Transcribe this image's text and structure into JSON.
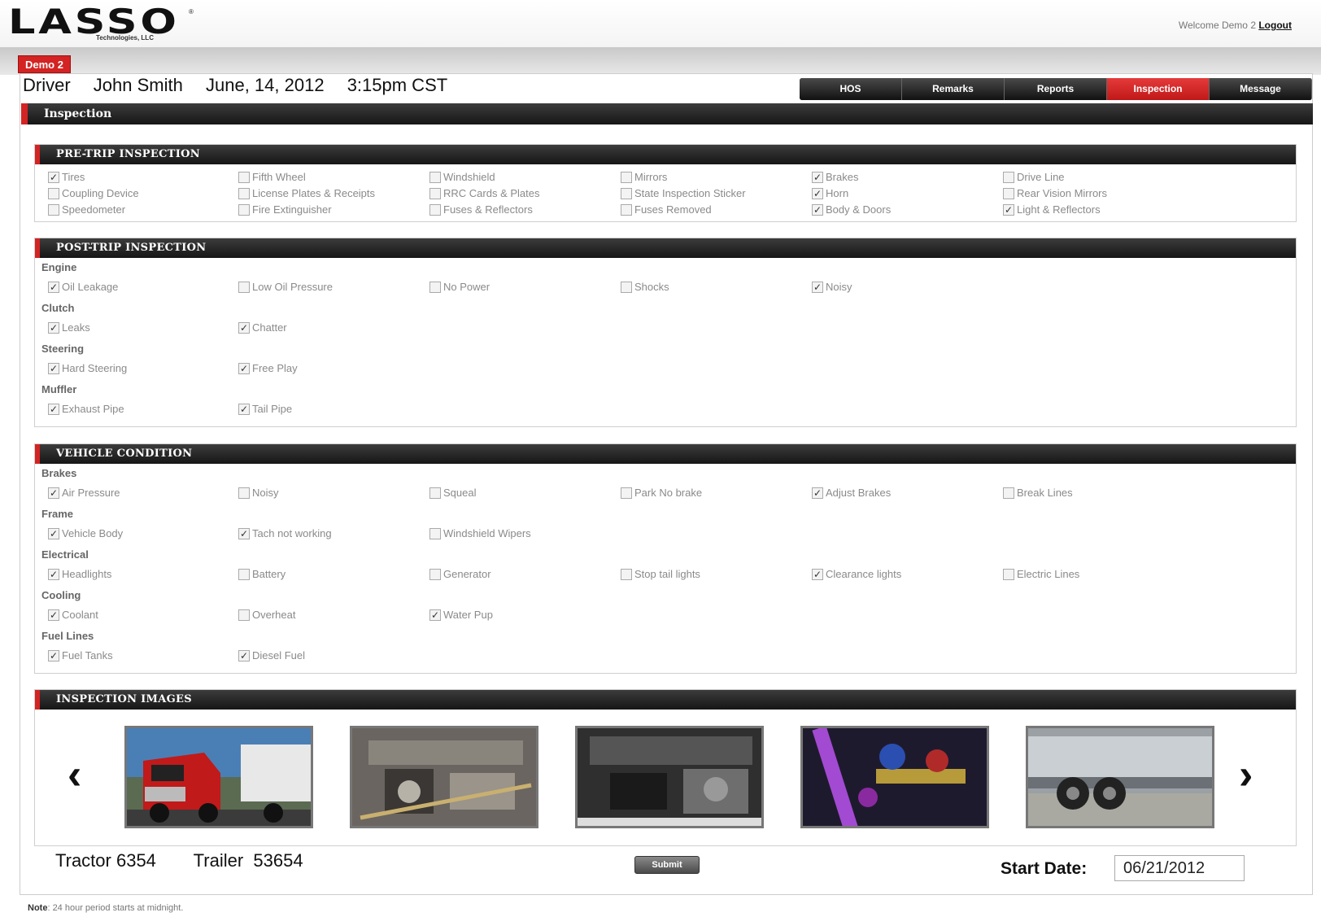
{
  "header": {
    "logo_mark": "LASSO",
    "logo_tm": "®",
    "logo_sub": "Technologies, LLC",
    "welcome": "Welcome Demo 2",
    "logout": "Logout",
    "account_tab": "Demo 2"
  },
  "driver": {
    "label": "Driver",
    "name": "John Smith",
    "date": "June, 14, 2012",
    "time": "3:15pm CST"
  },
  "nav": [
    {
      "label": "HOS",
      "active": false
    },
    {
      "label": "Remarks",
      "active": false
    },
    {
      "label": "Reports",
      "active": false
    },
    {
      "label": "Inspection",
      "active": true
    },
    {
      "label": "Message",
      "active": false
    }
  ],
  "page_title": "Inspection",
  "pretrip": {
    "title": "PRE-TRIP INSPECTION",
    "rows": [
      [
        {
          "l": "Tires",
          "c": true
        },
        {
          "l": "Fifth Wheel",
          "c": false
        },
        {
          "l": "Windshield",
          "c": false
        },
        {
          "l": "Mirrors",
          "c": false
        },
        {
          "l": "Brakes",
          "c": true
        },
        {
          "l": "Drive Line",
          "c": false
        }
      ],
      [
        {
          "l": "Coupling Device",
          "c": false
        },
        {
          "l": "License Plates & Receipts",
          "c": false
        },
        {
          "l": "RRC Cards & Plates",
          "c": false
        },
        {
          "l": "State Inspection Sticker",
          "c": false
        },
        {
          "l": "Horn",
          "c": true
        },
        {
          "l": "Rear Vision Mirrors",
          "c": false
        }
      ],
      [
        {
          "l": "Speedometer",
          "c": false
        },
        {
          "l": "Fire Extinguisher",
          "c": false
        },
        {
          "l": "Fuses & Reflectors",
          "c": false
        },
        {
          "l": "Fuses Removed",
          "c": false
        },
        {
          "l": "Body & Doors",
          "c": true
        },
        {
          "l": "Light & Reflectors",
          "c": true
        }
      ]
    ]
  },
  "posttrip": {
    "title": "POST-TRIP INSPECTION",
    "groups": [
      {
        "name": "Engine",
        "items": [
          {
            "l": "Oil Leakage",
            "c": true
          },
          {
            "l": "Low Oil Pressure",
            "c": false
          },
          {
            "l": "No Power",
            "c": false
          },
          {
            "l": "Shocks",
            "c": false
          },
          {
            "l": "Noisy",
            "c": true
          }
        ]
      },
      {
        "name": "Clutch",
        "items": [
          {
            "l": "Leaks",
            "c": true
          },
          {
            "l": "Chatter",
            "c": true
          }
        ]
      },
      {
        "name": "Steering",
        "items": [
          {
            "l": "Hard Steering",
            "c": true
          },
          {
            "l": "Free Play",
            "c": true
          }
        ]
      },
      {
        "name": "Muffler",
        "items": [
          {
            "l": "Exhaust Pipe",
            "c": true
          },
          {
            "l": "Tail Pipe",
            "c": true
          }
        ]
      }
    ]
  },
  "vehicle": {
    "title": "VEHICLE CONDITION",
    "groups": [
      {
        "name": "Brakes",
        "items": [
          {
            "l": "Air Pressure",
            "c": true
          },
          {
            "l": "Noisy",
            "c": false
          },
          {
            "l": "Squeal",
            "c": false
          },
          {
            "l": "Park No brake",
            "c": false
          },
          {
            "l": "Adjust Brakes",
            "c": true
          },
          {
            "l": "Break Lines",
            "c": false
          }
        ]
      },
      {
        "name": "Frame",
        "items": [
          {
            "l": "Vehicle Body",
            "c": true
          },
          {
            "l": "Tach not working",
            "c": true
          },
          {
            "l": "Windshield Wipers",
            "c": false
          }
        ]
      },
      {
        "name": "Electrical",
        "items": [
          {
            "l": "Headlights",
            "c": true
          },
          {
            "l": "Battery",
            "c": false
          },
          {
            "l": "Generator",
            "c": false
          },
          {
            "l": "Stop tail lights",
            "c": false
          },
          {
            "l": "Clearance lights",
            "c": true
          },
          {
            "l": "Electric Lines",
            "c": false
          }
        ]
      },
      {
        "name": "Cooling",
        "items": [
          {
            "l": "Coolant",
            "c": true
          },
          {
            "l": "Overheat",
            "c": false
          },
          {
            "l": "Water Pup",
            "c": true
          }
        ]
      },
      {
        "name": "Fuel Lines",
        "items": [
          {
            "l": "Fuel Tanks",
            "c": true
          },
          {
            "l": "Diesel Fuel",
            "c": true
          }
        ]
      }
    ]
  },
  "images": {
    "title": "INSPECTION IMAGES",
    "prev": "‹",
    "next": "›",
    "thumbs": [
      "red-truck-photo",
      "engine-bay-photo",
      "engine-compartment-photo",
      "gauge-valves-photo",
      "trailer-wheel-photo"
    ]
  },
  "footer": {
    "tractor": "Tractor 6354",
    "trailer": "Trailer  53654",
    "submit": "Submit",
    "start_label": "Start Date:",
    "start_value": "06/21/2012",
    "note_label": "Note",
    "note_text": ": 24 hour period starts at midnight."
  },
  "colors": {
    "accent": "#d32323",
    "bar_dark": "#1c1c1c"
  }
}
